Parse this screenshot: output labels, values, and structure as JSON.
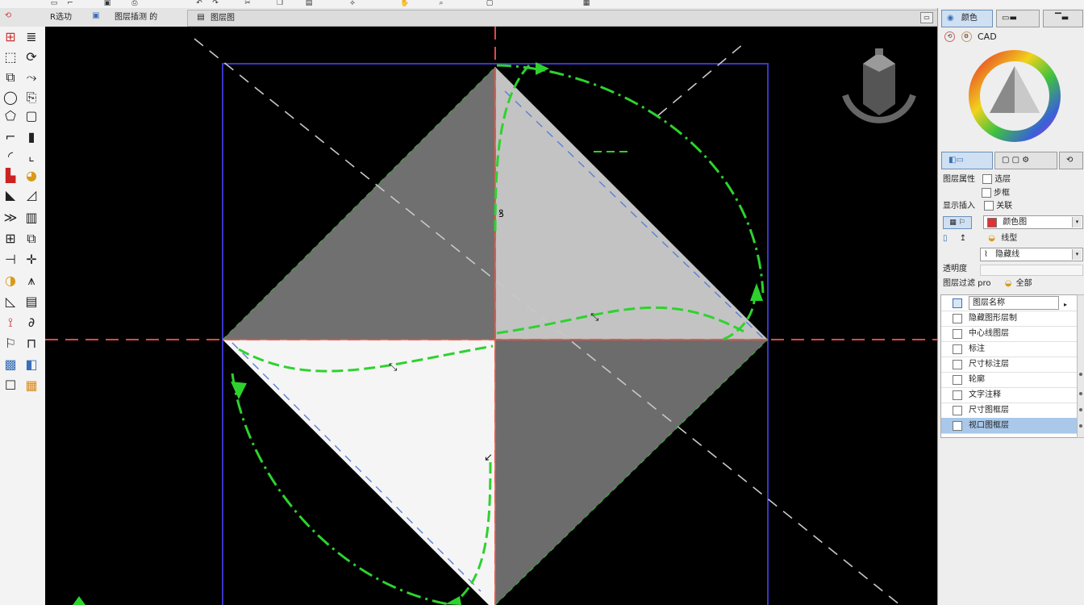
{
  "toolbar": {
    "icons": [
      "new-icon",
      "open-icon",
      "save-icon",
      "print-icon",
      "undo-icon",
      "redo-icon",
      "cut-icon",
      "copy-icon",
      "paste-icon",
      "match-icon",
      "pan-icon",
      "zoom-icon",
      "window-icon",
      "properties-icon"
    ]
  },
  "tabs": {
    "tab1_label": "R选功",
    "tab2_label": "图层插测 的",
    "doc_label": "图层图"
  },
  "right_panel": {
    "top_tab1": "颜色",
    "top_tab2": "",
    "top_tab3": "",
    "cad_label": "CAD",
    "prop_label_1": "图层属性",
    "prop_check_1": "选层",
    "prop_check_2": "步框",
    "prop_label_2": "显示插入",
    "prop_check_3": "关联",
    "combo_1": "颜色图",
    "prop_label_3": "线型",
    "combo_2": "隐藏线",
    "prop_label_4": "透明度",
    "prop_label_5": "图层过滤 pro",
    "prop_label_6": "全部",
    "layers": [
      {
        "label": "图层名称",
        "selected": false
      },
      {
        "label": "隐藏图形层制",
        "selected": false
      },
      {
        "label": "中心线图层",
        "selected": false
      },
      {
        "label": "标注",
        "selected": false
      },
      {
        "label": "尺寸标注层",
        "selected": false
      },
      {
        "label": "轮廓",
        "selected": false
      },
      {
        "label": "文字注释",
        "selected": false
      },
      {
        "label": "尺寸图框层",
        "selected": false
      },
      {
        "label": "视口图框层",
        "selected": true
      }
    ]
  },
  "colors": {
    "canvas_bg": "#000000",
    "red_axis": "#e04646",
    "green_arc": "#2ed22e",
    "blue_box": "#3a35c8",
    "blue_dashed": "#5a7fd6",
    "gray_dashed": "#c8c8c8",
    "dark_fill": "#707070",
    "light_fill": "#c3c3c3",
    "white_fill": "#f5f5f5",
    "selection_blue": "#a9c8ea"
  }
}
